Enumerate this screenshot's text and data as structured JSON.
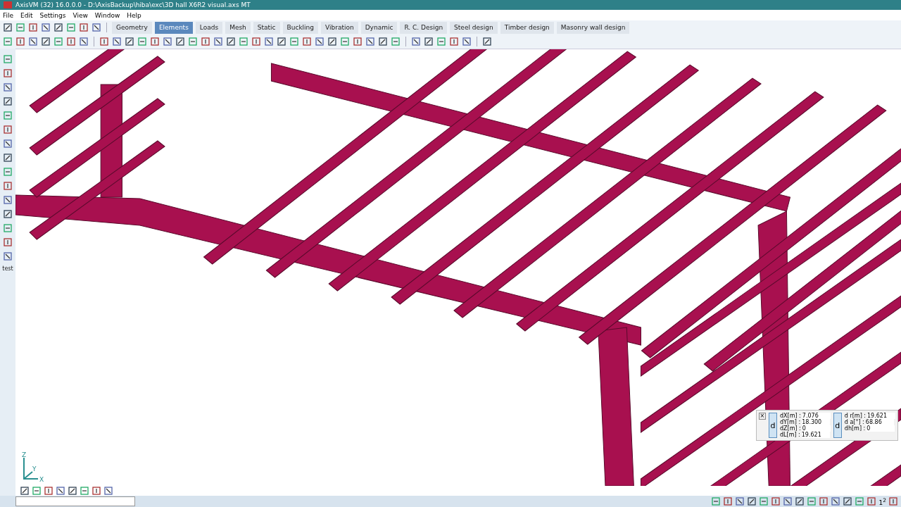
{
  "window": {
    "title": "AxisVM (32) 16.0.0.0 - D:\\AxisBackup\\hiba\\exc\\3D hall X6R2 visual.axs MT"
  },
  "menu": [
    "File",
    "Edit",
    "Settings",
    "View",
    "Window",
    "Help"
  ],
  "tabs": [
    {
      "label": "Geometry",
      "selected": false
    },
    {
      "label": "Elements",
      "selected": true
    },
    {
      "label": "Loads",
      "selected": false
    },
    {
      "label": "Mesh",
      "selected": false
    },
    {
      "label": "Static",
      "selected": false
    },
    {
      "label": "Buckling",
      "selected": false
    },
    {
      "label": "Vibration",
      "selected": false
    },
    {
      "label": "Dynamic",
      "selected": false
    },
    {
      "label": "R. C. Design",
      "selected": false
    },
    {
      "label": "Steel design",
      "selected": false
    },
    {
      "label": "Timber design",
      "selected": false
    },
    {
      "label": "Masonry wall design",
      "selected": false
    }
  ],
  "left_toolbar": {
    "label": "test"
  },
  "axes": {
    "x": "X",
    "y": "Y",
    "z": "Z"
  },
  "coordinates": {
    "close": "×",
    "left_badge": "d",
    "left": [
      {
        "label": "dX[m] :",
        "value": "7.076"
      },
      {
        "label": "dY[m] :",
        "value": "18.300"
      },
      {
        "label": "dZ[m] :",
        "value": "0"
      },
      {
        "label": "dL[m] :",
        "value": "19.621"
      }
    ],
    "right_badge": "d",
    "right": [
      {
        "label": "d r[m] :",
        "value": "19.621"
      },
      {
        "label": "d  a[°] :",
        "value": "68.86"
      },
      {
        "label": "dh[m] :",
        "value": "0"
      }
    ]
  },
  "status_bar": {
    "superscript": "1$^{2}$"
  }
}
